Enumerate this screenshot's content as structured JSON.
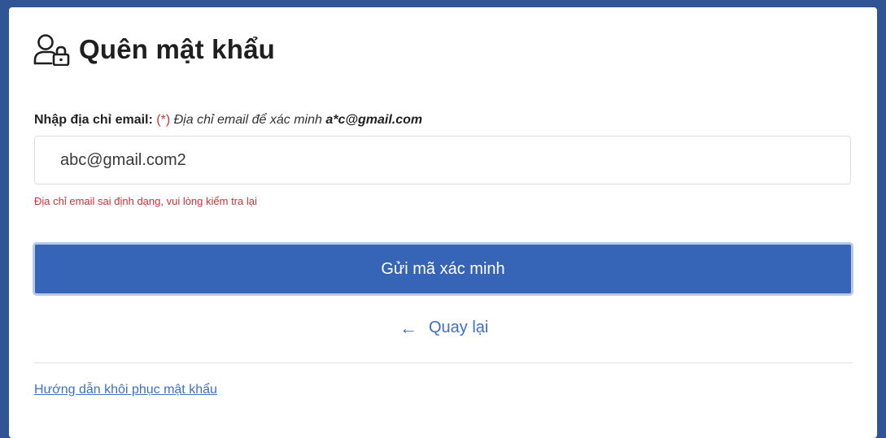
{
  "page": {
    "title": "Quên mật khẩu",
    "title_icon": "user-lock-icon"
  },
  "form": {
    "label": "Nhập địa chỉ email:",
    "required_mark": "(*)",
    "hint": "Địa chỉ email để xác minh",
    "hint_email": "a*c@gmail.com",
    "email_value": "abc@gmail.com2",
    "error": "Địa chỉ email sai định dạng, vui lòng kiểm tra lại",
    "submit_label": "Gửi mã xác minh"
  },
  "back": {
    "icon": "arrow-left-icon",
    "label": "Quay lại"
  },
  "footer": {
    "guide_link": "Hướng dẫn khôi phục mật khẩu"
  },
  "colors": {
    "background": "#2f5596",
    "primary": "#3665b8",
    "link": "#3f6fc6",
    "error": "#d0313b"
  }
}
